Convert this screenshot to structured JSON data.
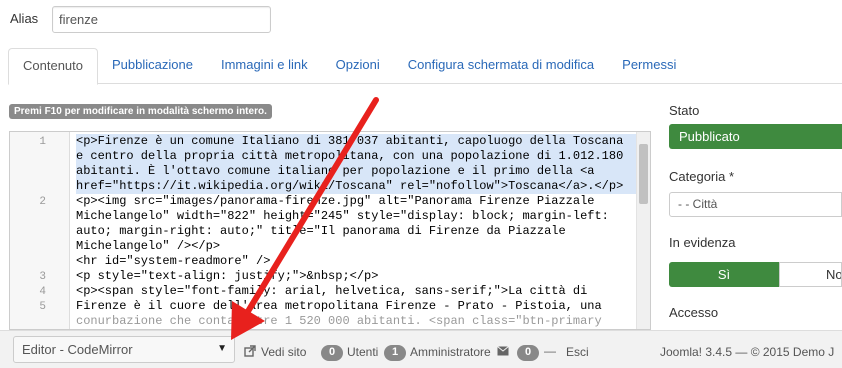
{
  "alias": {
    "label": "Alias",
    "value": "firenze"
  },
  "tabs": [
    {
      "label": "Contenuto",
      "active": true
    },
    {
      "label": "Pubblicazione"
    },
    {
      "label": "Immagini e link"
    },
    {
      "label": "Opzioni"
    },
    {
      "label": "Configura schermata di modifica"
    },
    {
      "label": "Permessi"
    }
  ],
  "hint": "Premi F10 per modificare in modalità schermo intero.",
  "editor": {
    "line_numbers": [
      "1",
      "2",
      "3",
      "4",
      "5"
    ],
    "lines": [
      "<p>Firenze è un comune Italiano di 381 037 abitanti, capoluogo della Toscana",
      "e centro della propria città metropolitana, con una popolazione di 1.012.180",
      "abitanti. È l'ottavo comune italiano per popolazione e il primo della <a",
      "href=\"https://it.wikipedia.org/wiki/Toscana\" rel=\"nofollow\">Toscana</a>.</p>",
      "<p><img src=\"images/panorama-firenze.jpg\" alt=\"Panorama Firenze Piazzale",
      "Michelangelo\" width=\"822\" height=\"245\" style=\"display: block; margin-left:",
      "auto; margin-right: auto;\" title=\"Il panorama di Firenze da Piazzale",
      "Michelangelo\" /></p>",
      "<hr id=\"system-readmore\" />",
      "<p style=\"text-align: justify;\">&nbsp;</p>",
      "<p><span style=\"font-family: arial, helvetica, sans-serif;\">La città di",
      "Firenze è il cuore dell'area metropolitana Firenze - Prato - Pistoia, una",
      "conurbazione che conta oltre 1 520 000 abitanti. <span class=\"btn-primary"
    ]
  },
  "sidebar": {
    "stato_label": "Stato",
    "stato_value": "Pubblicato",
    "categoria_label": "Categoria *",
    "categoria_value": "- - Città",
    "evidenza_label": "In evidenza",
    "evidenza_yes": "Sì",
    "evidenza_no": "No",
    "accesso_label": "Accesso"
  },
  "statusbar": {
    "editor_select": "Editor - CodeMirror",
    "vedi_sito": "Vedi sito",
    "utenti_count": "0",
    "utenti_label": "Utenti",
    "admin_count": "1",
    "admin_label": "Amministratore",
    "msg_count": "0",
    "esci": "Esci",
    "version": "Joomla! 3.4.5 — © 2015 Demo J"
  },
  "colors": {
    "primary_green": "#3f8a3f",
    "link_blue": "#2a69b8",
    "arrow_red": "#e8211d"
  }
}
